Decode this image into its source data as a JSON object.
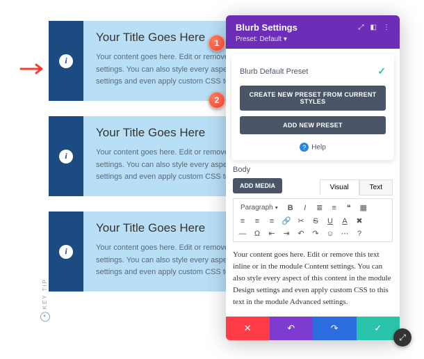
{
  "blurbs": [
    {
      "title": "Your Title Goes Here",
      "text": "Your content goes here. Edit or remove this text inline or in the module Content settings. You can also style every aspect of this content in the module Design settings and even apply custom CSS to this text in the module Advanced settings."
    },
    {
      "title": "Your Title Goes Here",
      "text": "Your content goes here. Edit or remove this text inline or in the module Content settings. You can also style every aspect of this content in the module Design settings and even apply custom CSS to this text in the module Advanced settings."
    },
    {
      "title": "Your Title Goes Here",
      "text": "Your content goes here. Edit or remove this text inline or in the module Content settings. You can also style every aspect of this content in the module Design settings and even apply custom CSS to this text in the module Advanced settings."
    }
  ],
  "panel": {
    "title": "Blurb Settings",
    "preset_label": "Preset: Default ▾",
    "preset_item": "Blurb Default Preset",
    "create_btn": "CREATE NEW PRESET FROM CURRENT STYLES",
    "add_btn": "ADD NEW PRESET",
    "help": "Help",
    "body_label": "Body",
    "media_btn": "ADD MEDIA",
    "tabs": {
      "visual": "Visual",
      "text": "Text"
    },
    "paragraph": "Paragraph",
    "content": "Your content goes here. Edit or remove this text inline or in the module Content settings. You can also style every aspect of this content in the module Design settings and even apply custom CSS to this text in the module Advanced settings."
  },
  "callouts": {
    "one": "1",
    "two": "2"
  },
  "keytip": "KEY TIP",
  "info_glyph": "i"
}
